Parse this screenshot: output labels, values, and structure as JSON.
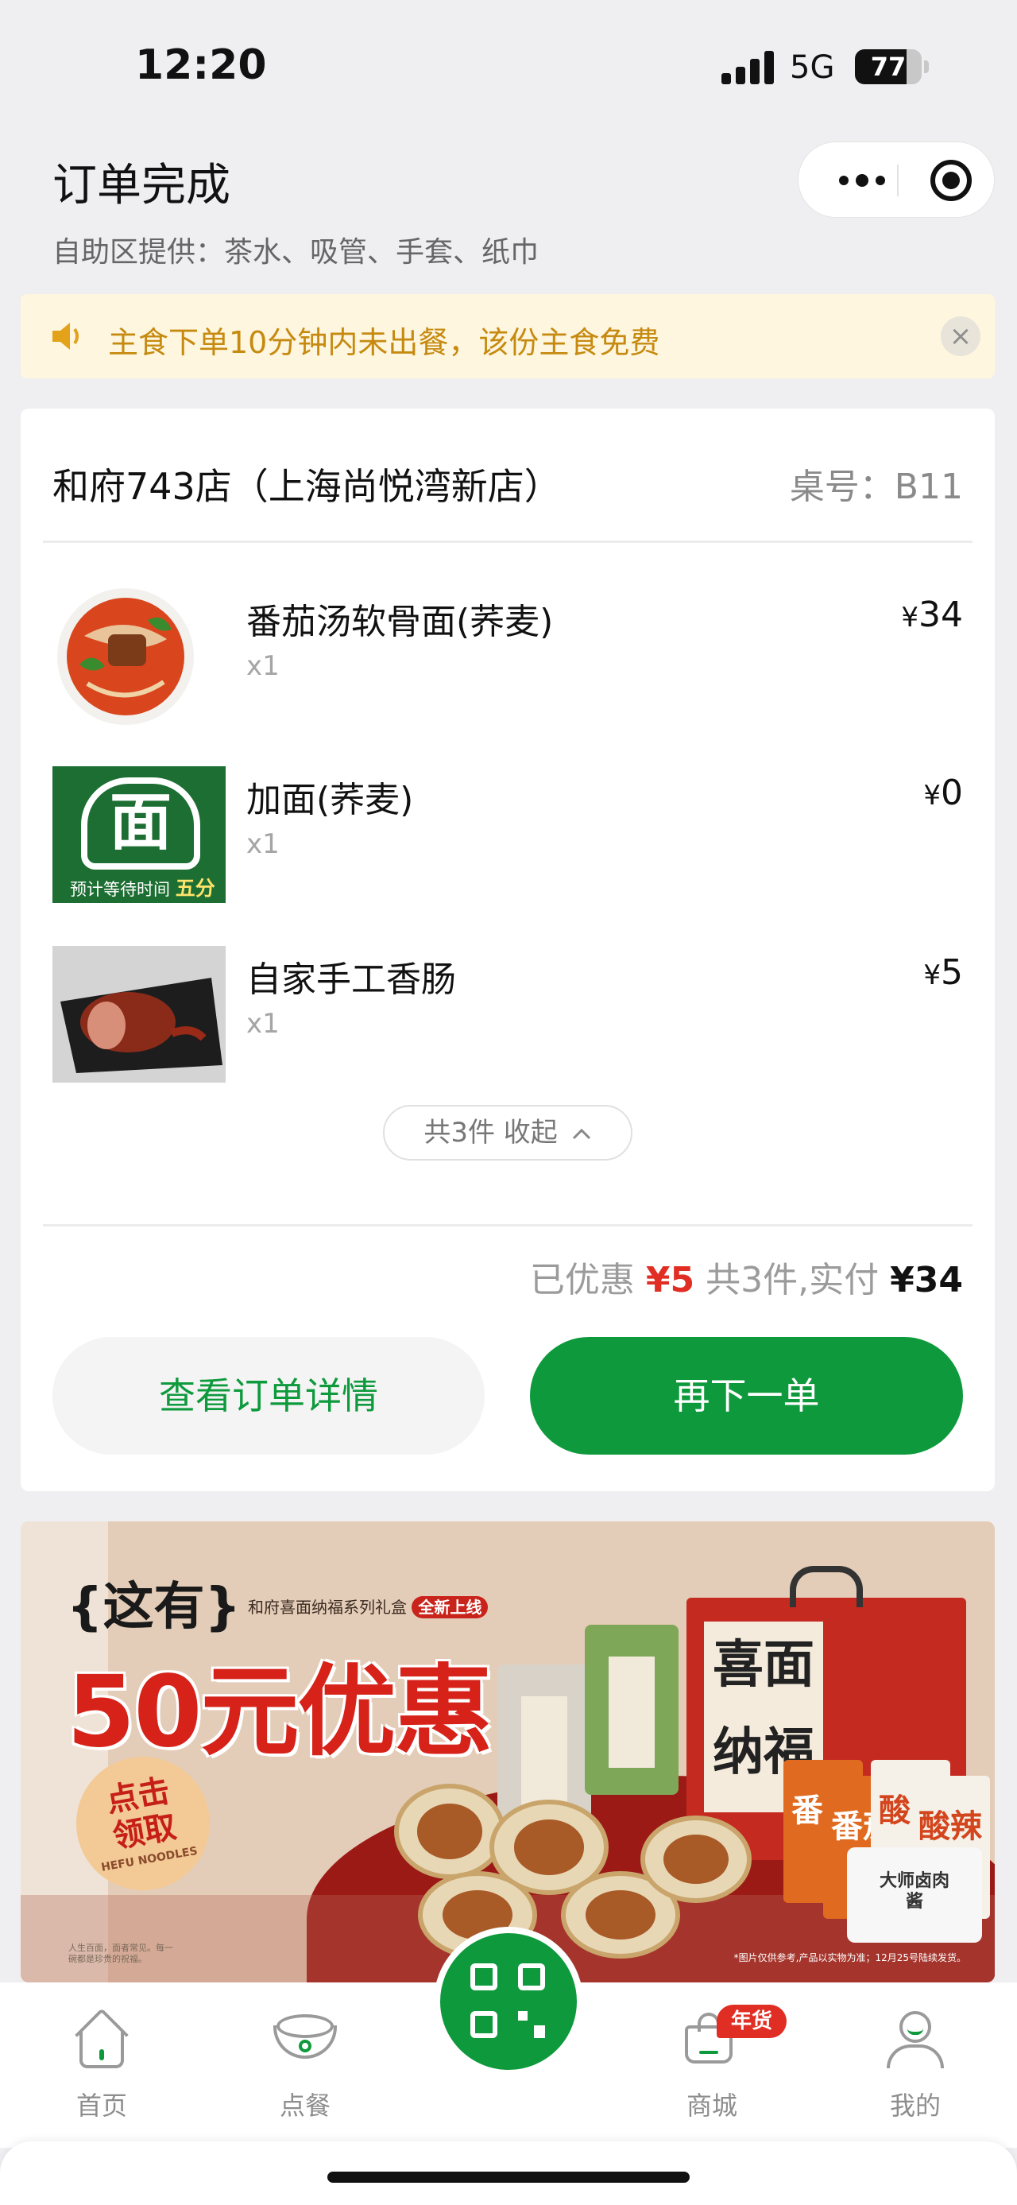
{
  "status_bar": {
    "time": "12:20",
    "network": "5G",
    "battery": "77",
    "battery_level": 0.77
  },
  "header": {
    "title": "订单完成",
    "subtitle": "自助区提供：茶水、吸管、手套、纸巾",
    "capsule_more_icon": "more-dots-icon",
    "capsule_close_icon": "target-circle-icon"
  },
  "notice": {
    "text": "主食下单10分钟内未出餐，该份主食免费",
    "color": "#c68a10",
    "close_glyph": "×"
  },
  "order": {
    "store_name": "和府743店（上海尚悦湾新店）",
    "table_no": "桌号：B11",
    "items": [
      {
        "name": "番茄汤软骨面(荞麦)",
        "qty": "x1",
        "currency": "¥",
        "price": "34"
      },
      {
        "name": "加面(荞麦)",
        "qty": "x1",
        "currency": "¥",
        "price": "0"
      },
      {
        "name": "自家手工香肠",
        "qty": "x1",
        "currency": "¥",
        "price": "5"
      }
    ],
    "mian_thumb": {
      "char": "面",
      "wait_label": "预计等待时间",
      "wait_value": "五分钟"
    },
    "collapse_label": "共3件 收起",
    "collapse_icon": "chevron-up-icon",
    "totals": {
      "discount_label": "已优惠",
      "discount_value": "¥5",
      "summary": "共3件,实付",
      "paid_value": "¥34"
    },
    "detail_button": "查看订单详情",
    "reorder_button": "再下一单"
  },
  "banner": {
    "headline_small": "{这有}",
    "tag_text": "和府喜面纳福系列礼盒",
    "tag_badge": "全新上线",
    "headline_big": "50元优惠",
    "badge_line1": "点击",
    "badge_line2": "领取",
    "badge_en": "HEFU NOODLES",
    "fine_print": "人生百面，面者常见。每一碗都是珍贵的祝福。",
    "note": "*图片仅供参考,产品以实物为准；12月25号陆续发货。",
    "box_label": "喜面纳福",
    "pack_labels": [
      "番茄",
      "番茄",
      "酸辣",
      "酸辣"
    ],
    "white_pack_label": "大师卤肉酱"
  },
  "tabbar": {
    "tabs": [
      {
        "label": "首页",
        "icon": "home-icon"
      },
      {
        "label": "点餐",
        "icon": "bowl-icon"
      },
      {
        "label": "商城",
        "icon": "shopping-bag-icon"
      },
      {
        "label": "我的",
        "icon": "user-icon"
      }
    ],
    "scan_icon": "qr-code-icon",
    "mall_badge": "年货"
  },
  "colors": {
    "brand_green": "#0e9a3c",
    "price_red": "#e02e24",
    "notice_bg": "#fef6df"
  }
}
